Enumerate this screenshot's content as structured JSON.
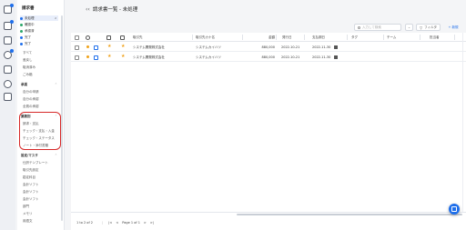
{
  "rail": {
    "icons": [
      "document-icon",
      "invoice-icon",
      "bank-icon",
      "link-icon",
      "calendar-icon",
      "sync-icon",
      "settings-icon"
    ]
  },
  "sidebar": {
    "title": "請求書",
    "status_items": [
      {
        "label": "未処理",
        "color": "#1f6feb",
        "count": "2",
        "selected": true
      },
      {
        "label": "確認中",
        "color": "#2ca86b"
      },
      {
        "label": "承認済",
        "color": "#2ca86b"
      },
      {
        "label": "完了",
        "color": "#1f6feb"
      },
      {
        "label": "完了",
        "color": "#1f6feb"
      }
    ],
    "plain_items": [
      "すべて",
      "差戻し",
      "取消済み",
      "ごみ箱"
    ],
    "section1": {
      "title": "承認",
      "items": [
        "自分の申請",
        "自分の承認",
        "全員の承認"
      ]
    },
    "section2": {
      "title": "業務別",
      "items": [
        "請求・支払",
        "チェック・支払・入金",
        "チェック・ステータス",
        "ノート・添付書類"
      ]
    },
    "section3": {
      "title": "設定/マスタ",
      "items": [
        "仕訳テンプレート",
        "取引先設定",
        "勘定科目",
        "会計ソフト",
        "会計ソフト",
        "会計ソフト",
        "部門",
        "メモリ",
        "用語文"
      ]
    }
  },
  "header": {
    "back_icon": "‹‹",
    "title": "請求書一覧 - 未処理"
  },
  "toolbar": {
    "search_placeholder": "入力して検索",
    "options_label": "⌄",
    "filter_label": "フィルタ",
    "new_label": "+ 新規"
  },
  "table": {
    "columns": [
      "取引先",
      "取引先カナ名",
      "金額",
      "発行日",
      "支払期日",
      "タグ",
      "チーム",
      "担当者"
    ],
    "rows": [
      {
        "vendor": "システム開発株式会社",
        "kana": "システムカイハツ",
        "amount": "880,000",
        "issue_date": "2022-10-21",
        "due_date": "2022-11-30"
      },
      {
        "vendor": "システム開発株式会社",
        "kana": "システムカイハツ",
        "amount": "880,000",
        "issue_date": "2022-10-21",
        "due_date": "2022-11-30"
      }
    ]
  },
  "pager": {
    "range": "1 to 2 of 2",
    "first": "|<",
    "prev": "<",
    "page": "Page 1 of 1",
    "next": ">",
    "last": ">|"
  },
  "colors": {
    "accent": "#1f6feb",
    "highlight": "#d62828",
    "flag": "#f0a21b"
  }
}
